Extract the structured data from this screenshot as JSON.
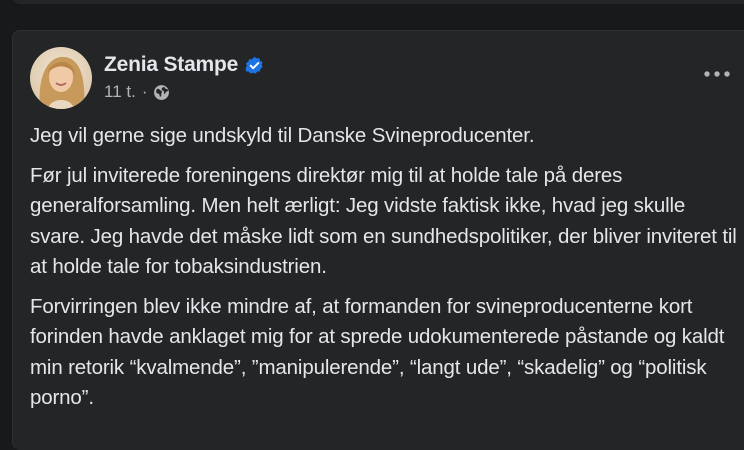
{
  "post": {
    "author_name": "Zenia Stampe",
    "verified_icon": "verified-badge-icon",
    "timestamp": "11 t.",
    "separator": "·",
    "audience_icon": "globe-icon",
    "more_icon": "more-options-icon",
    "paragraphs": [
      "Jeg vil gerne sige undskyld til Danske Svineproducenter.",
      "Før jul inviterede foreningens direktør mig til at holde tale på deres generalforsamling. Men helt ærligt: Jeg vidste faktisk ikke, hvad jeg skulle svare. Jeg havde det måske lidt som en sundhedspolitiker, der bliver inviteret til at holde tale for tobaksindustrien.",
      "Forvirringen blev ikke mindre af, at formanden for svineproducenterne kort forinden havde anklaget mig for at sprede udokumenterede påstande og kaldt min retorik “kvalmende”, ”manipulerende”, “langt ude”, “skadelig” og “politisk porno”."
    ]
  },
  "colors": {
    "page_bg": "#18191a",
    "card_bg": "#242526",
    "text_primary": "#e4e6eb",
    "text_secondary": "#b0b3b8",
    "verified_blue": "#1b74e4"
  }
}
